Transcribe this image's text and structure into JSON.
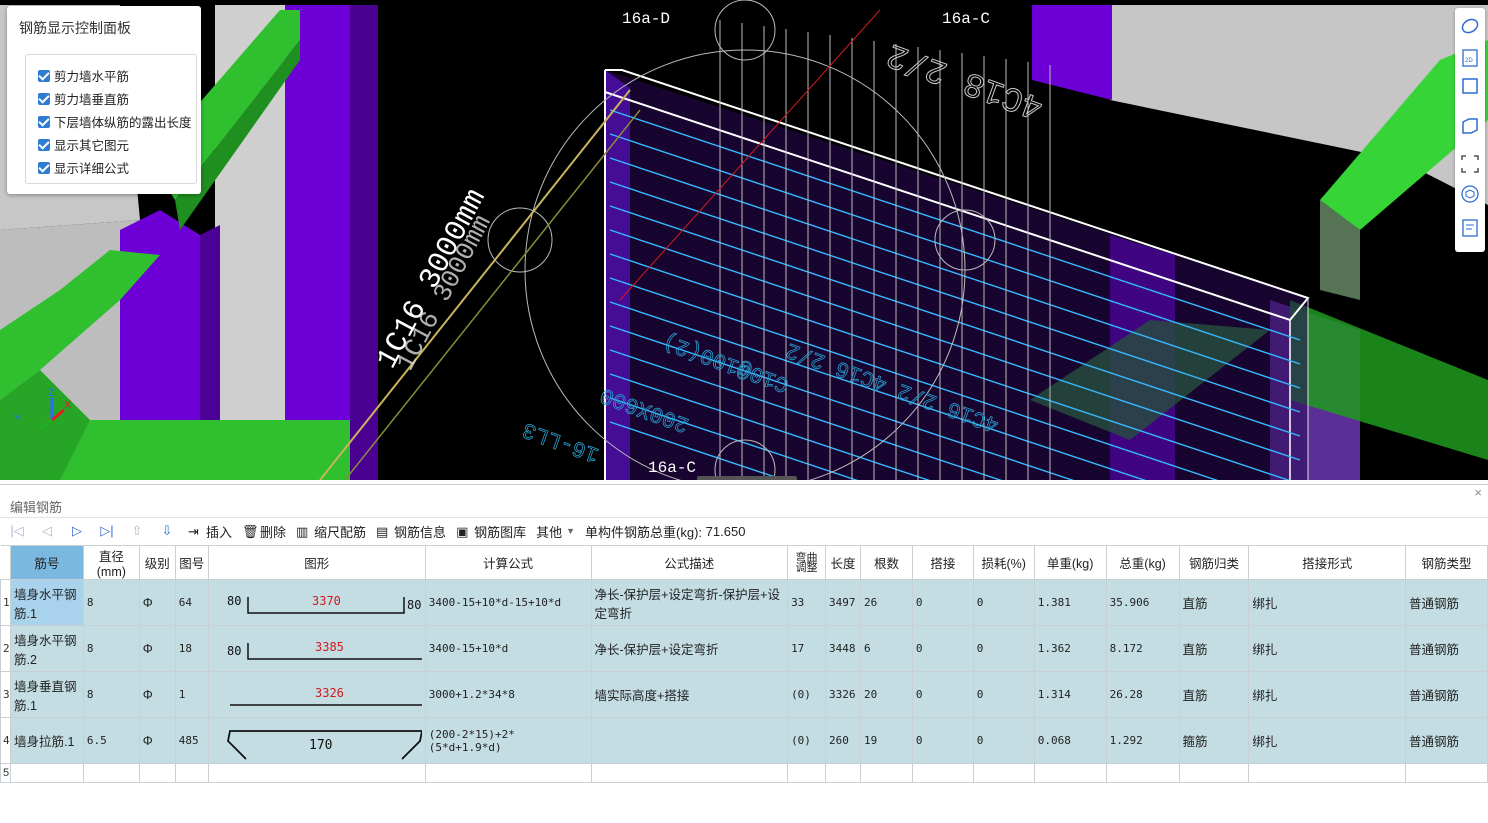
{
  "viewport": {
    "labels": {
      "axis_d": "16a-D",
      "axis_c_top": "16a-C",
      "axis_c_bottom": "16a-C",
      "dim_text": "1C16 3000mm",
      "dim_text_2": "1C16 3000mm",
      "rebar_note": "4C18 2/2",
      "floor_note_1": "4C16 2/2 4C16 2/2",
      "floor_note_2": "C10@100(2)",
      "floor_note_3": "200X600",
      "floor_note_4": "16-LL3"
    },
    "colors": {
      "green": "#2db52d",
      "purple": "#6a00d0",
      "gray": "#c9c9c9",
      "wall_rebar": "#2ab6ff"
    },
    "axes": {
      "z": "Z",
      "x": "X",
      "y": "Y"
    }
  },
  "control_panel": {
    "title": "钢筋显示控制面板",
    "options": [
      {
        "label": "剪力墙水平筋",
        "checked": true
      },
      {
        "label": "剪力墙垂直筋",
        "checked": true
      },
      {
        "label": "下层墙体纵筋的露出长度",
        "checked": true
      },
      {
        "label": "显示其它图元",
        "checked": true
      },
      {
        "label": "显示详细公式",
        "checked": true
      }
    ]
  },
  "right_toolbar": [
    "orbit-icon",
    "2d-icon",
    "cube-front-icon",
    "cube-iso-icon",
    "fit-view-icon",
    "view-cube-icon",
    "settings-list-icon"
  ],
  "editor": {
    "title": "编辑钢筋",
    "close": "×",
    "toolbar": {
      "insert": "插入",
      "delete": "删除",
      "scale_config": "缩尺配筋",
      "rebar_info": "钢筋信息",
      "rebar_library": "钢筋图库",
      "other": "其他",
      "total_weight_label": "单构件钢筋总重(kg):",
      "total_weight_value": "71.650"
    },
    "columns": [
      "筋号",
      "直径(mm)",
      "级别",
      "图号",
      "图形",
      "计算公式",
      "公式描述",
      "弯曲调整",
      "长度",
      "根数",
      "搭接",
      "损耗(%)",
      "单重(kg)",
      "总重(kg)",
      "钢筋归类",
      "搭接形式",
      "钢筋类型"
    ],
    "rows": [
      {
        "idx": "1",
        "name": "墙身水平钢筋.1",
        "dia": "8",
        "grade": "Φ",
        "fig": "64",
        "shape_left": "80",
        "shape_mid": "3370",
        "shape_right": "80",
        "formula": "3400-15+10*d-15+10*d",
        "desc": "净长-保护层+设定弯折-保护层+设定弯折",
        "bend": "33",
        "length": "3497",
        "count": "26",
        "lap": "0",
        "loss": "0",
        "unit_w": "1.381",
        "total_w": "35.906",
        "category": "直筋",
        "lap_form": "绑扎",
        "type": "普通钢筋"
      },
      {
        "idx": "2",
        "name": "墙身水平钢筋.2",
        "dia": "8",
        "grade": "Φ",
        "fig": "18",
        "shape_left": "80",
        "shape_mid": "3385",
        "formula": "3400-15+10*d",
        "desc": "净长-保护层+设定弯折",
        "bend": "17",
        "length": "3448",
        "count": "6",
        "lap": "0",
        "loss": "0",
        "unit_w": "1.362",
        "total_w": "8.172",
        "category": "直筋",
        "lap_form": "绑扎",
        "type": "普通钢筋"
      },
      {
        "idx": "3",
        "name": "墙身垂直钢筋.1",
        "dia": "8",
        "grade": "Φ",
        "fig": "1",
        "shape_mid": "3326",
        "formula": "3000+1.2*34*8",
        "desc": "墙实际高度+搭接",
        "bend": "(0)",
        "length": "3326",
        "count": "20",
        "lap": "0",
        "loss": "0",
        "unit_w": "1.314",
        "total_w": "26.28",
        "category": "直筋",
        "lap_form": "绑扎",
        "type": "普通钢筋"
      },
      {
        "idx": "4",
        "name": "墙身拉筋.1",
        "dia": "6.5",
        "grade": "Φ",
        "fig": "485",
        "shape_mid": "170",
        "formula": "(200-2*15)+2*(5*d+1.9*d)",
        "desc": "",
        "bend": "(0)",
        "length": "260",
        "count": "19",
        "lap": "0",
        "loss": "0",
        "unit_w": "0.068",
        "total_w": "1.292",
        "category": "箍筋",
        "lap_form": "绑扎",
        "type": "普通钢筋"
      },
      {
        "idx": "5"
      }
    ]
  }
}
